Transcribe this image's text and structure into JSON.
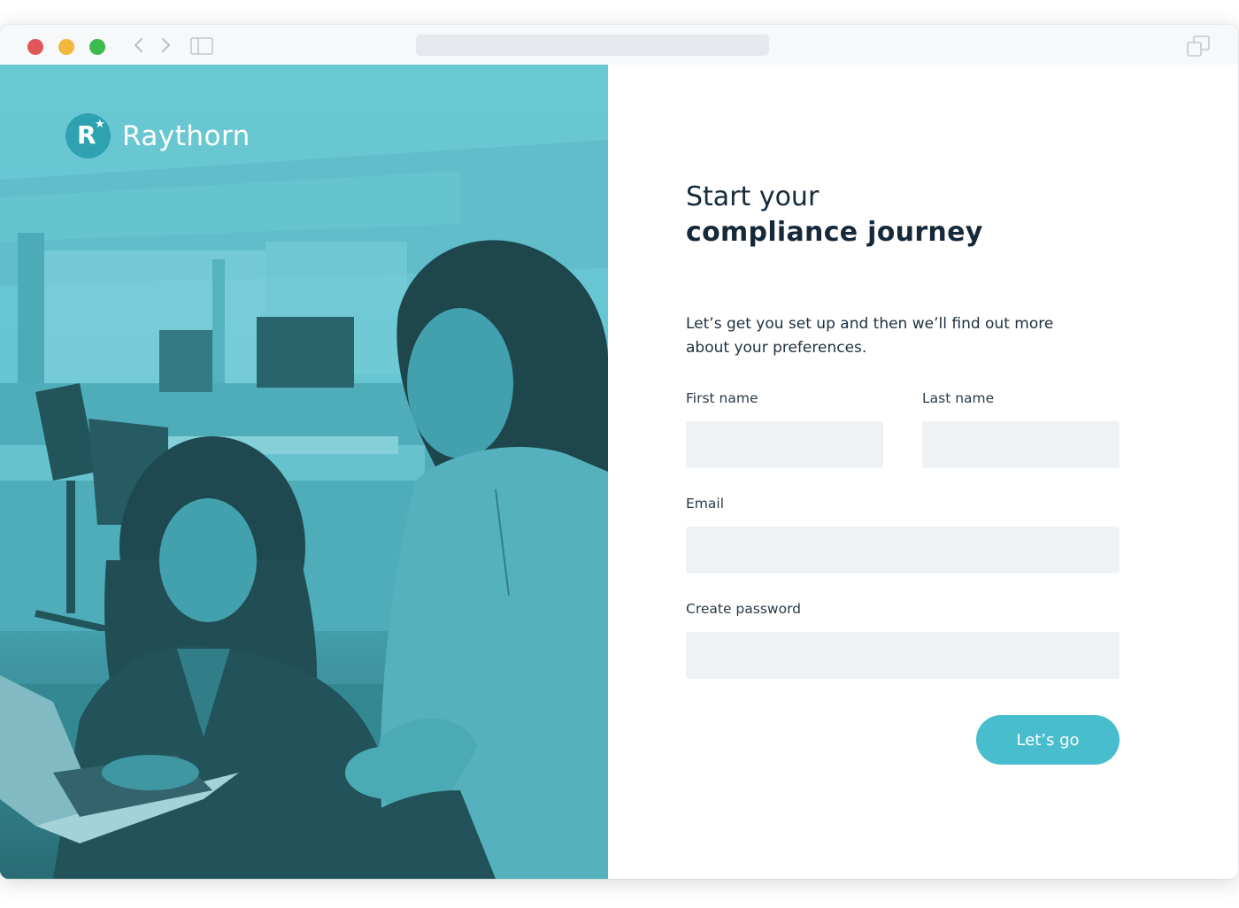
{
  "browser": {
    "traffic_lights": [
      "close",
      "minimize",
      "zoom"
    ],
    "icons": [
      "chevron-left-icon",
      "chevron-right-icon",
      "sidebar-icon",
      "tabs-icon"
    ]
  },
  "brand": {
    "logo_letter": "R",
    "logo_star": "★",
    "name": "Raythorn",
    "accent_color": "#47bdcd",
    "hero_tint": "#5bb7c3"
  },
  "form": {
    "headline_line1": "Start your",
    "headline_line2": "compliance journey",
    "intro": "Let’s get you set up and then we’ll find out more about your preferences.",
    "fields": {
      "first_name": {
        "label": "First name",
        "value": "",
        "placeholder": ""
      },
      "last_name": {
        "label": "Last name",
        "value": "",
        "placeholder": ""
      },
      "email": {
        "label": "Email",
        "value": "",
        "placeholder": ""
      },
      "password": {
        "label": "Create password",
        "value": "",
        "placeholder": ""
      }
    },
    "submit_label": "Let’s go"
  }
}
